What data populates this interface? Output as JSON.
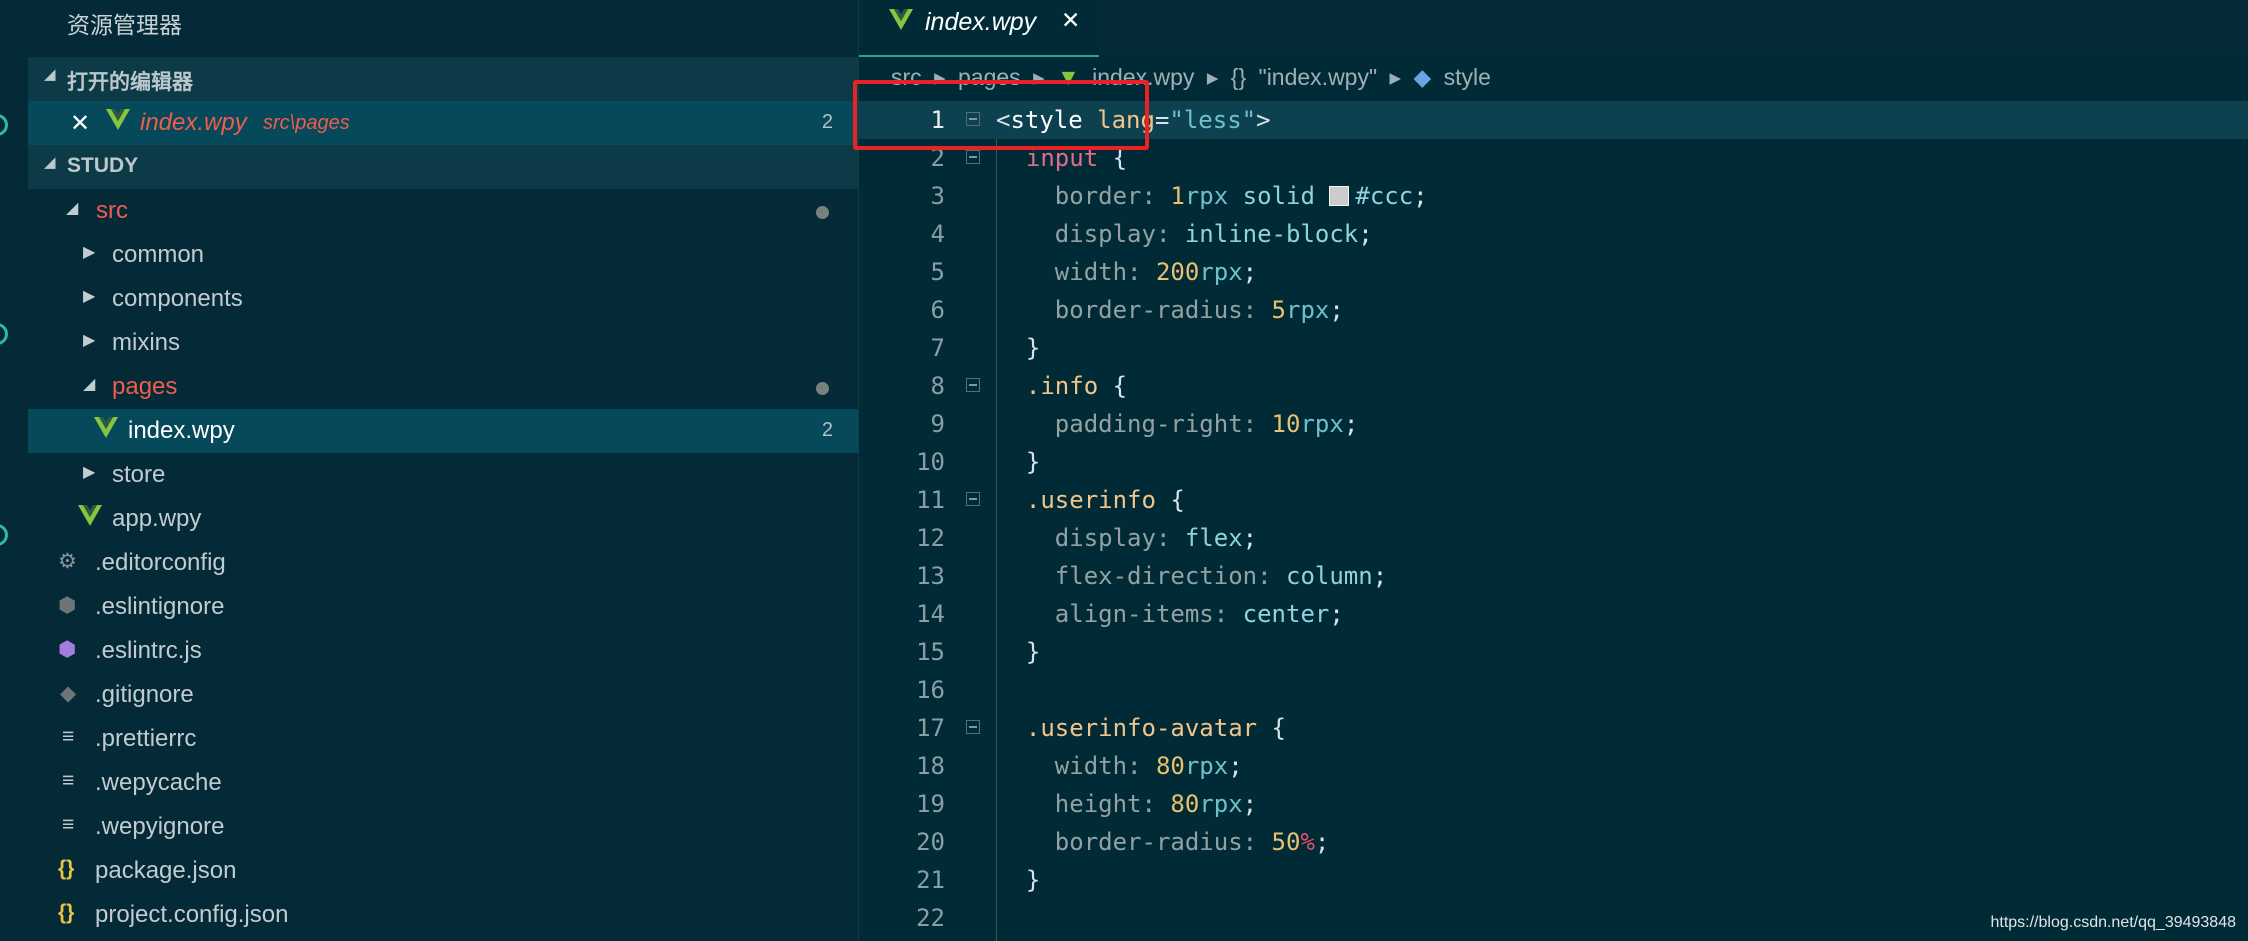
{
  "sidebar": {
    "title": "资源管理器",
    "open_editors": {
      "header": "打开的编辑器",
      "item": {
        "name": "index.wpy",
        "path": "src\\pages",
        "badge": "2"
      }
    },
    "workspace": {
      "header": "STUDY",
      "src": "src",
      "common": "common",
      "components": "components",
      "mixins": "mixins",
      "pages": "pages",
      "index": "index.wpy",
      "index_badge": "2",
      "store": "store",
      "app": "app.wpy",
      "editorconfig": ".editorconfig",
      "eslintignore": ".eslintignore",
      "eslintrc": ".eslintrc.js",
      "gitignore": ".gitignore",
      "prettierrc": ".prettierrc",
      "wepycache": ".wepycache",
      "wepyignore": ".wepyignore",
      "package": "package.json",
      "project_config": "project.config.json"
    }
  },
  "editor": {
    "tab_label": "index.wpy",
    "breadcrumb": [
      "src",
      "pages",
      "index.wpy",
      "\"index.wpy\"",
      "style"
    ],
    "line_numbers": [
      "1",
      "2",
      "3",
      "4",
      "5",
      "6",
      "7",
      "8",
      "9",
      "10",
      "11",
      "12",
      "13",
      "14",
      "15",
      "16",
      "17",
      "18",
      "19",
      "20",
      "21",
      "22"
    ]
  },
  "watermark": "https://blog.csdn.net/qq_39493848",
  "colors": {
    "background": "#002b36",
    "accent": "#2aa198",
    "highlight_box": "#ea2226"
  }
}
